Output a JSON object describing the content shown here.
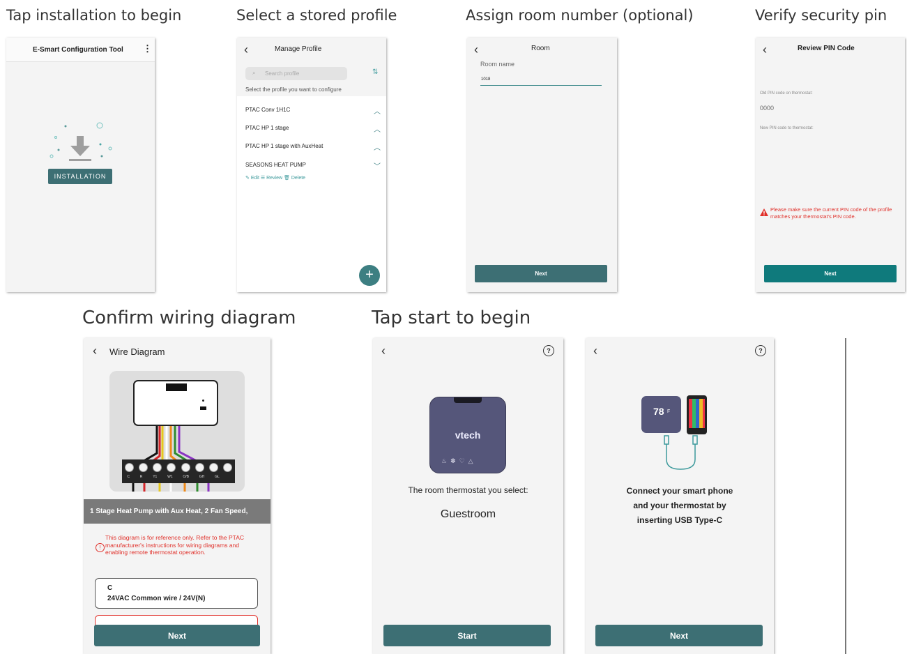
{
  "captions": {
    "c1": "Tap installation to begin",
    "c2": "Select a stored profile",
    "c3": "Assign room number (optional)",
    "c4": "Verify security pin",
    "c5": "Confirm wiring diagram",
    "c6": "Tap start to begin"
  },
  "screen1": {
    "title": "E-Smart Configuration Tool",
    "install_label": "INSTALLATION"
  },
  "screen2": {
    "title": "Manage Profile",
    "search_placeholder": "Search profile",
    "hint": "Select the profile you want to configure",
    "profiles": [
      "PTAC Conv 1H1C",
      "PTAC HP 1 stage",
      "PTAC HP 1 stage with AuxHeat",
      "SEASONS HEAT PUMP"
    ],
    "actions": {
      "edit": "Edit",
      "review": "Review",
      "delete": "Delete"
    }
  },
  "screen3": {
    "title": "Room",
    "field_label": "Room name",
    "field_value": "1018",
    "next": "Next"
  },
  "screen4": {
    "title": "Review PIN Code",
    "old_label": "Old PIN code on thermostat:",
    "old_value": "0000",
    "new_label": "New PIN code to thermostat:",
    "warning": "Please make sure the current PIN code of the profile matches your thermostat's PIN code.",
    "next": "Next"
  },
  "screen5": {
    "title": "Wire Diagram",
    "terminals": [
      "C",
      "R",
      "Y1",
      "W1",
      "O/B",
      "GH",
      "GL",
      ""
    ],
    "wire_colors": [
      "#111111",
      "#d4262a",
      "#e6c81e",
      "#ffffff",
      "#ee8a1a",
      "#2e8b2e",
      "#8a34c2"
    ],
    "banner": "1 Stage Heat Pump with Aux Heat, 2 Fan Speed,",
    "note": "This diagram is for reference only. Refer to the PTAC manufacturer's instructions for wiring diagrams and enabling remote thermostat operation.",
    "card_title": "C",
    "card_desc": "24VAC Common wire / 24V(N)",
    "next": "Next"
  },
  "screen6": {
    "brand": "vtech",
    "label": "The room thermostat you select:",
    "value": "Guestroom",
    "start": "Start"
  },
  "screen7": {
    "thermo_temp": "78",
    "thermo_unit": "F",
    "text_lines": [
      "Connect your smart phone",
      "and your thermostat by",
      "inserting USB Type-C"
    ],
    "next": "Next"
  },
  "colors": {
    "accent": "#3d6f74",
    "accent_dark": "#0f7a7c",
    "warning": "#e0302a",
    "teal": "#3d9a9c"
  }
}
